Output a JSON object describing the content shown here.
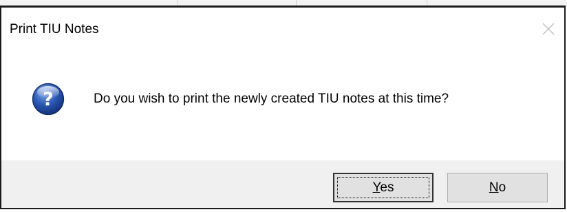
{
  "dialog": {
    "title": "Print TIU Notes",
    "message": "Do you wish to print the newly created TIU notes at this time?",
    "icon": "question-icon",
    "buttons": {
      "yes": {
        "mnemonic": "Y",
        "rest": "es"
      },
      "no": {
        "mnemonic": "N",
        "rest": "o"
      }
    },
    "default_button": "yes"
  },
  "colors": {
    "icon_blue": "#2a58b4",
    "footer_bg": "#f0f0f0",
    "button_bg": "#e1e1e1"
  }
}
